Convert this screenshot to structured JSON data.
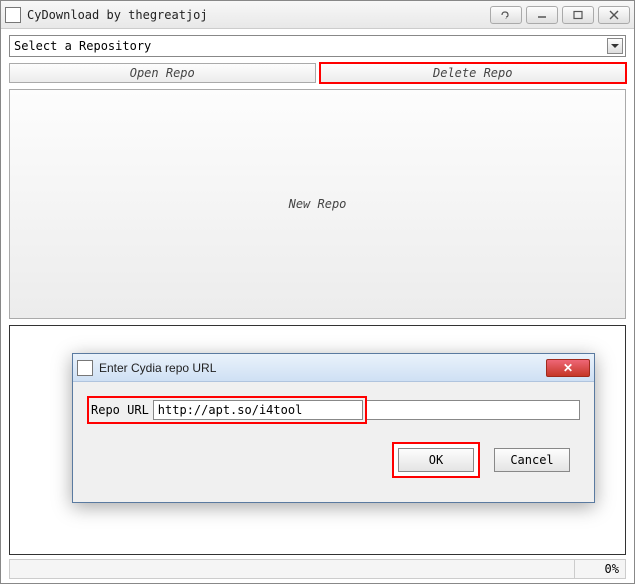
{
  "window": {
    "title": "CyDownload by thegreatjoj"
  },
  "repo_select": {
    "placeholder": "Select a Repository"
  },
  "buttons": {
    "open_repo": "Open Repo",
    "delete_repo": "Delete Repo",
    "new_repo": "New Repo"
  },
  "dialog": {
    "title": "Enter Cydia repo URL",
    "label": "Repo URL",
    "value": "http://apt.so/i4tool",
    "ok": "OK",
    "cancel": "Cancel",
    "close": "✕"
  },
  "status": {
    "percent": "0%"
  }
}
